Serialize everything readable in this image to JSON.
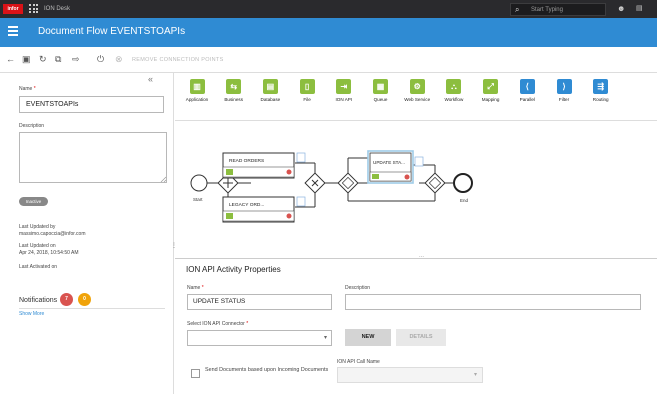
{
  "topbar": {
    "logo": "infor",
    "app_title": "ION Desk",
    "search_placeholder": "Start Typing",
    "search_icon": "search-icon",
    "user_icon": "user-icon",
    "messages_icon": "messages-icon"
  },
  "header": {
    "title": "Document Flow EVENTSTOAPIs",
    "menu_icon": "hamburger-icon",
    "color": "#2f8bd3"
  },
  "toolbar": {
    "icons": [
      "back-arrow-icon",
      "save-icon",
      "refresh-icon",
      "copy-icon",
      "export-icon",
      "power-icon",
      "close-icon"
    ],
    "remove_label": "REMOVE CONNECTION POINTS"
  },
  "left": {
    "collapse_icon": "double-chevron-left-icon",
    "name_label": "Name",
    "required_mark": "*",
    "name_value": "EVENTSTOAPIs",
    "description_label": "Description",
    "status_badge": "Inactive",
    "last_updated_by_label": "Last Updated by",
    "last_updated_by_value": "massimo.capoccia@infor.com",
    "last_updated_on_label": "Last Updated on",
    "last_updated_on_value": "Apr 24, 2018, 10:54:50 AM",
    "last_activated_label": "Last Activated on",
    "notifications_label": "Notifications",
    "notif_red_count": "7",
    "notif_orange_count": "0",
    "show_more": "Show More"
  },
  "palette": {
    "items": [
      {
        "label": "Application",
        "color": "#8cbe3f",
        "icon": "application-icon",
        "glyph": "▥"
      },
      {
        "label": "Business",
        "color": "#8cbe3f",
        "icon": "business-icon",
        "glyph": "⇆"
      },
      {
        "label": "Database",
        "color": "#8cbe3f",
        "icon": "database-icon",
        "glyph": "▤"
      },
      {
        "label": "File",
        "color": "#8cbe3f",
        "icon": "file-icon",
        "glyph": "▯"
      },
      {
        "label": "ION API",
        "color": "#8cbe3f",
        "icon": "ion-api-icon",
        "glyph": "⇥"
      },
      {
        "label": "Queue",
        "color": "#8cbe3f",
        "icon": "queue-icon",
        "glyph": "▦"
      },
      {
        "label": "Web Service",
        "color": "#8cbe3f",
        "icon": "web-service-icon",
        "glyph": "⚙"
      },
      {
        "label": "Workflow",
        "color": "#8cbe3f",
        "icon": "workflow-icon",
        "glyph": "⛬"
      },
      {
        "label": "Mapping",
        "color": "#8cbe3f",
        "icon": "mapping-icon",
        "glyph": "⤢"
      },
      {
        "label": "Parallel",
        "color": "#2f8bd3",
        "icon": "parallel-icon",
        "glyph": "⟨"
      },
      {
        "label": "Filter",
        "color": "#2f8bd3",
        "icon": "filter-icon",
        "glyph": "⟩"
      },
      {
        "label": "Routing",
        "color": "#2f8bd3",
        "icon": "routing-icon",
        "glyph": "⇶"
      }
    ]
  },
  "flow": {
    "start_label": "Start",
    "end_label": "End",
    "nodes": [
      {
        "label": "READ ORDERS",
        "icon": "database-icon"
      },
      {
        "label": "LEGACY ORD...",
        "icon": "file-icon"
      },
      {
        "label": "UPDATE STA...",
        "icon": "ion-api-icon"
      }
    ]
  },
  "props": {
    "heading": "ION API Activity Properties",
    "name_label": "Name",
    "name_value": "UPDATE STATUS",
    "description_label": "Description",
    "connector_label": "Select ION API Connector",
    "new_button": "NEW",
    "details_button": "DETAILS",
    "send_docs_label": "Send Documents based upon Incoming Documents",
    "call_name_label": "ION API Call Name"
  }
}
